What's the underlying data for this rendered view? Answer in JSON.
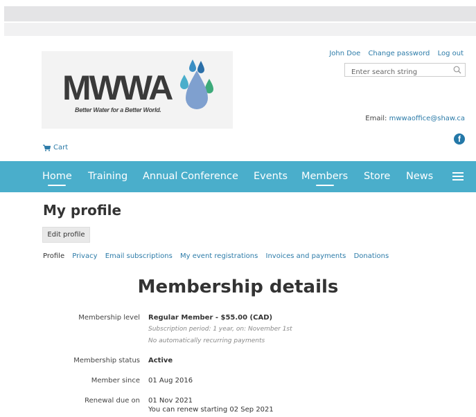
{
  "header": {
    "logo_text": "MWWA",
    "logo_tagline": "Better Water for a Better World.",
    "user_links": [
      "John Doe",
      "Change password",
      "Log out"
    ],
    "search_placeholder": "Enter search string",
    "email_label": "Email:",
    "email": "mwwaoffice@shaw.ca",
    "cart_label": "Cart"
  },
  "nav": {
    "items": [
      "Home",
      "Training",
      "Annual Conference",
      "Events",
      "Members",
      "Store",
      "News"
    ]
  },
  "page": {
    "title": "My profile",
    "edit_button": "Edit profile",
    "subnav": [
      "Profile",
      "Privacy",
      "Email subscriptions",
      "My event registrations",
      "Invoices and payments",
      "Donations"
    ],
    "section_title": "Membership details",
    "details": {
      "level_label": "Membership level",
      "level_value": "Regular Member - $55.00 (CAD)",
      "level_note1": "Subscription period: 1 year, on: November 1st",
      "level_note2": "No automatically recurring payments",
      "status_label": "Membership status",
      "status_value": "Active",
      "since_label": "Member since",
      "since_value": "01 Aug 2016",
      "renewal_label": "Renewal due on",
      "renewal_value": "01 Nov 2021",
      "renewal_note": "You can renew starting 02 Sep 2021"
    }
  },
  "colors": {
    "nav_bg": "#4aaecb",
    "link": "#2c7ba8"
  }
}
